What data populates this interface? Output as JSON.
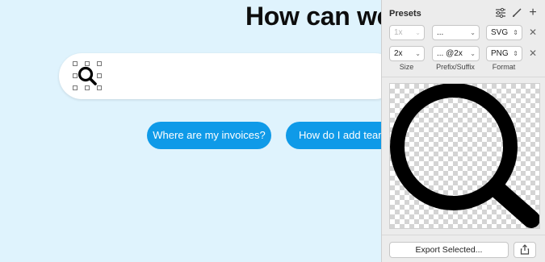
{
  "canvas": {
    "headline": "How can we",
    "suggestions": [
      "Where are my invoices?",
      "How do I add team m"
    ]
  },
  "panel": {
    "title": "Presets",
    "icons": [
      "sliders-icon",
      "brush-icon",
      "plus-icon"
    ],
    "rows": [
      {
        "size": "1x",
        "prefix": "...",
        "format": "SVG",
        "disabled": true
      },
      {
        "size": "2x",
        "prefix": "... @2x",
        "format": "PNG",
        "disabled": false
      }
    ],
    "col_size": "Size",
    "col_prefix": "Prefix/Suffix",
    "col_format": "Format",
    "export_label": "Export Selected...",
    "share_icon": "share-icon"
  }
}
